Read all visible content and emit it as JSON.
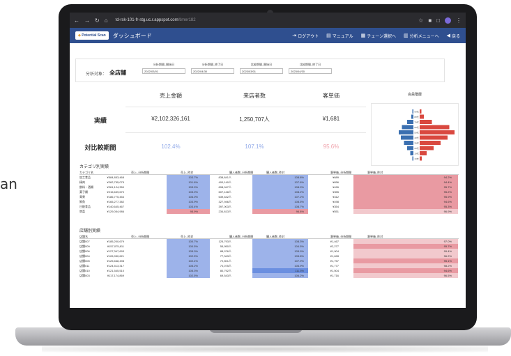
{
  "side_text": "an",
  "browser": {
    "url_host": "td-rsk-101-fr-stg.uc.r.appspot.com",
    "url_path": "/timer182"
  },
  "header": {
    "logo_text": "Potential Scan",
    "title": "ダッシュボード",
    "nav": [
      {
        "label": "ログアウト",
        "icon": "logout-icon"
      },
      {
        "label": "マニュアル",
        "icon": "manual-icon"
      },
      {
        "label": "チェーン選択へ",
        "icon": "chain-select-icon"
      },
      {
        "label": "分析メニューへ",
        "icon": "analysis-menu-icon"
      },
      {
        "label": "戻る",
        "icon": "back-icon"
      }
    ]
  },
  "filter": {
    "label": "分析対象：",
    "store": "全店舗",
    "dates": [
      {
        "label": "分析期間_開始日",
        "value": "2022/03/01"
      },
      {
        "label": "分析期間_終了日",
        "value": "2022/04/30"
      },
      {
        "label": "比較期間_開始日",
        "value": "2023/03/01"
      },
      {
        "label": "比較期間_終了日",
        "value": "2023/04/30"
      }
    ]
  },
  "summary": {
    "columns": [
      "売上金額",
      "来店者数",
      "客単価"
    ],
    "actual_label": "実績",
    "actual": [
      "¥2,102,326,161",
      "1,250,707人",
      "¥1,681"
    ],
    "compare_label": "対比較期間",
    "compare": [
      "102.4%",
      "107.1%",
      "95.6%"
    ],
    "pyramid_title": "会員階層",
    "pyramid_male": [
      0.05,
      0.1,
      0.3,
      0.55,
      0.7,
      0.6,
      0.45,
      0.3,
      0.15,
      0.05
    ],
    "pyramid_female": [
      0.05,
      0.12,
      0.35,
      0.85,
      1.0,
      0.8,
      0.6,
      0.4,
      0.2,
      0.06
    ],
    "pyramid_labels": [
      "90代",
      "80代",
      "70代",
      "60代",
      "50代",
      "40代",
      "30代",
      "20代",
      "10代",
      "10未"
    ]
  },
  "category_table": {
    "title": "カテゴリ別実績",
    "headers": [
      "カテゴリ名",
      "売上_分析期間",
      "売上_昨対",
      "購入者数_分析期間",
      "購入者数_昨対",
      "客単価_分析期間",
      "客単価_昨対"
    ],
    "rows": [
      [
        "加工食品",
        "¥584,853,468",
        "103.7%",
        "838,841人",
        "108.8%",
        "¥689",
        "94.2%"
      ],
      [
        "精肉",
        "¥262,755,075",
        "101.6%",
        "400,140人",
        "107.6%",
        "¥656",
        "94.4%"
      ],
      [
        "飲料・酒類",
        "¥261,124,350",
        "103.9%",
        "698,947人",
        "108.9%",
        "¥426",
        "95.7%"
      ],
      [
        "菓子類",
        "¥215,639,670",
        "103.0%",
        "607,128人",
        "108.2%",
        "¥355",
        "95.2%"
      ],
      [
        "青果",
        "¥186,775,454",
        "106.0%",
        "639,642人",
        "107.2%",
        "¥312",
        "95.9%"
      ],
      [
        "鮮魚",
        "¥165,277,382",
        "103.9%",
        "327,946人",
        "108.5%",
        "¥498",
        "94.6%"
      ],
      [
        "日配食品",
        "¥140,645,467",
        "103.4%",
        "397,003人",
        "108.7%",
        "¥354",
        "95.3%"
      ],
      [
        "惣菜",
        "¥129,054,986",
        "95.9%",
        "234,813人",
        "96.8%",
        "¥551",
        "96.9%"
      ]
    ]
  },
  "store_table": {
    "title": "店舗別実績",
    "headers": [
      "店舗名",
      "売上_分析期間",
      "売上_昨対",
      "購入者数_分析期間",
      "購入者数_昨対",
      "客単価_分析期間",
      "客単価_昨対"
    ],
    "rows": [
      [
        "店舗007",
        "¥185,200,679",
        "100.7%",
        "125,793人",
        "108.3%",
        "¥1,467",
        "97.0%"
      ],
      [
        "店舗009",
        "¥157,075,811",
        "100.5%",
        "55,950人",
        "104.5%",
        "¥2,277",
        "95.7%"
      ],
      [
        "店舗006",
        "¥127,347,693",
        "105.0%",
        "88,976人",
        "105.9%",
        "¥1,904",
        "99.4%"
      ],
      [
        "店舗004",
        "¥126,950,621",
        "102.5%",
        "77,343人",
        "105.8%",
        "¥1,628",
        "96.2%"
      ],
      [
        "店舗005",
        "¥125,668,498",
        "102.4%",
        "72,501人",
        "107.9%",
        "¥1,757",
        "95.1%"
      ],
      [
        "店舗011",
        "¥124,513,317",
        "105.2%",
        "70,075人",
        "106.9%",
        "¥1,777",
        "98.2%"
      ],
      [
        "店舗010",
        "¥121,545,510",
        "105.3%",
        "80,792人",
        "111.3%",
        "¥1,504",
        "94.6%"
      ],
      [
        "店舗003",
        "¥117,174,869",
        "102.5%",
        "69,543人",
        "106.2%",
        "¥1,716",
        "96.5%"
      ]
    ]
  }
}
